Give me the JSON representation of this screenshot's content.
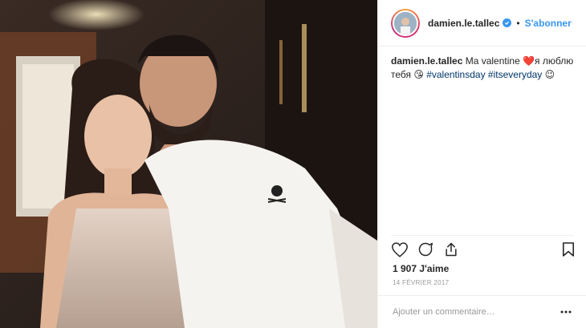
{
  "post": {
    "author": "damien.le.tallec",
    "follow_label": "S'abonner",
    "dot": "•",
    "caption": {
      "user": "damien.le.tallec",
      "text": " Ma valentine ❤️я люблю тебя 😘 ",
      "tags": [
        "#valentinsday",
        "#itseveryday"
      ],
      "trail": " 😉"
    },
    "likes": "1 907 J'aime",
    "date": "14 FÉVRIER 2017",
    "comment_placeholder": "Ajouter un commentaire…"
  },
  "icons": {
    "like": "heart-icon",
    "comment": "comment-icon",
    "share": "share-icon",
    "save": "bookmark-icon",
    "more": "more-dots-icon",
    "verified": "verified-badge-icon"
  },
  "colors": {
    "link_blue": "#3897f0",
    "hashtag": "#003569",
    "text": "#262626",
    "muted": "#999999"
  }
}
